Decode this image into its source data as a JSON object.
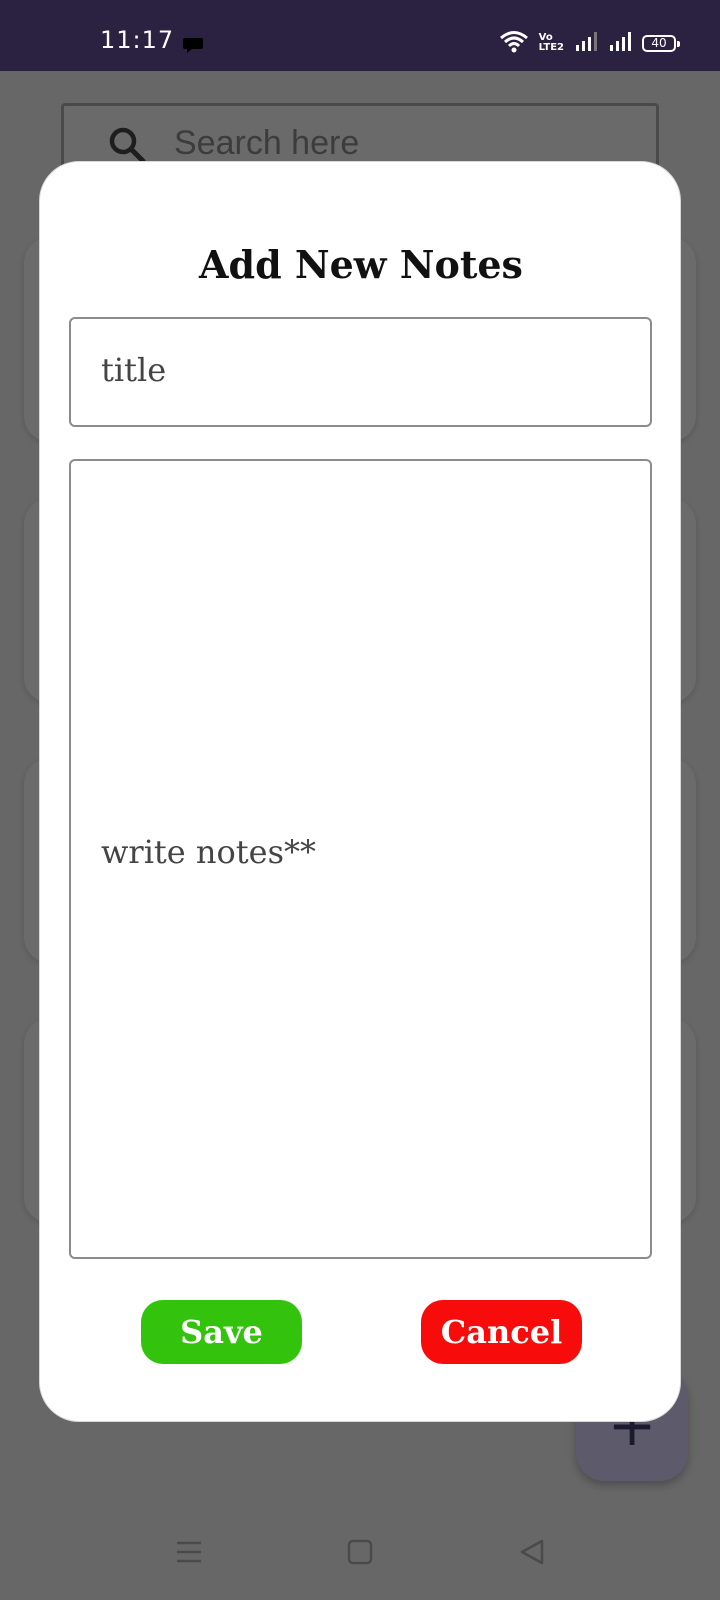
{
  "status_bar": {
    "time": "11:17",
    "volte_line1": "Vo",
    "volte_line2": "LTE2",
    "battery": "40",
    "icons": [
      "message-icon",
      "wifi-icon",
      "signal-icon",
      "signal-icon",
      "battery-icon"
    ]
  },
  "search": {
    "placeholder": "Search here"
  },
  "dialog": {
    "title": "Add New Notes",
    "title_placeholder": "title",
    "notes_placeholder": "write notes**",
    "save_label": "Save",
    "cancel_label": "Cancel"
  },
  "fab": {
    "icon": "plus-icon"
  },
  "nav_bar": {
    "icons": [
      "menu-icon",
      "home-icon",
      "back-icon"
    ]
  },
  "colors": {
    "status_bar": "#2b2140",
    "scrim": "#666766",
    "save": "#33c30c",
    "cancel": "#f70b0b"
  }
}
